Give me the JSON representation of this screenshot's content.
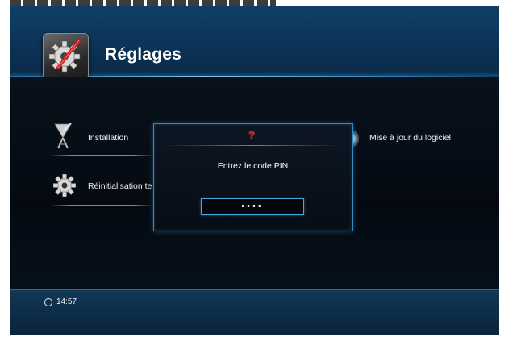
{
  "header": {
    "title": "Réglages"
  },
  "menu": {
    "items": [
      {
        "label": "Installation"
      },
      {
        "label": "Réinitialisation te"
      },
      {
        "label": "Mise à jour du logiciel"
      }
    ]
  },
  "dialog": {
    "icon_glyph": "?",
    "prompt": "Entrez le code PIN",
    "pin_value": "••••"
  },
  "footer": {
    "time": "14:57"
  },
  "colors": {
    "accent": "#2f8dc8",
    "header_bg": "#0f3f66",
    "footer_bg": "#123956",
    "warning": "#e02020"
  },
  "icons": [
    "settings-gear-icon",
    "satellite-dish-icon",
    "gear-icon",
    "disc-icon",
    "question-icon",
    "clock-icon"
  ]
}
